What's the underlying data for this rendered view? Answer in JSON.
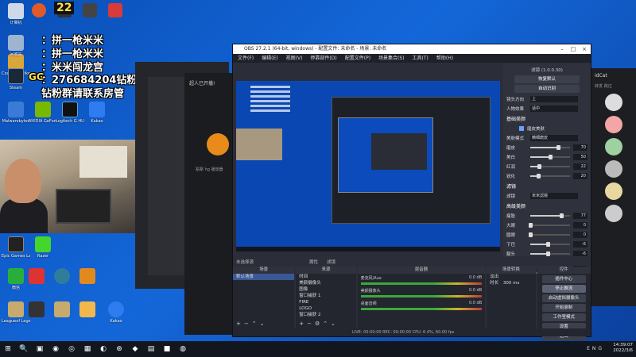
{
  "overlay": {
    "line1": "：拼一枪米米",
    "line2": "：拼一枪米米",
    "line3": "：米米闯龙宫",
    "line4": "：276684204钻粉群",
    "line5": "钻粉群请联系房管",
    "badge22": "22",
    "gg": "GG"
  },
  "desktop_icons": [
    {
      "label": "计算机",
      "color": "#cfd8e6"
    },
    {
      "label": "Counter-Strike",
      "color": "#d8a63a"
    },
    {
      "label": "回收站",
      "color": "#9fb4cf"
    },
    {
      "label": "Steam",
      "color": "#1b2838"
    },
    {
      "label": "Malwarebytes",
      "color": "#3a7bd5"
    },
    {
      "label": "NVIDIA GeForce",
      "color": "#76b900"
    },
    {
      "label": "Logitech G HUB",
      "color": "#111111"
    },
    {
      "label": "Epic Games Launcher",
      "color": "#222222"
    },
    {
      "label": "微信",
      "color": "#2aae3b"
    },
    {
      "label": "Leagueof Legends",
      "color": "#c8aa6e"
    },
    {
      "label": "Razer",
      "color": "#44d62c"
    },
    {
      "label": "Kakao",
      "color": "#2f7bf0"
    }
  ],
  "bg_app": {
    "left_text": "超人已开播!",
    "hint": "點擊 hg 播放器"
  },
  "obs": {
    "title": "OBS 27.2.1 (64-bit, windows) - 配置文件: 未命名 - 场景: 未命名",
    "menu": [
      "文件(F)",
      "编辑(E)",
      "视图(V)",
      "停靠部件(D)",
      "配置文件(P)",
      "场景集合(S)",
      "工具(T)",
      "帮助(H)"
    ],
    "props": {
      "title": "滤镜 (1.0.0.30)",
      "top_buttons": [
        "恢复默认",
        "自动识别"
      ],
      "face_label": "镜头方向",
      "face_value": "上",
      "person_label": "人物效果",
      "person_value": "适中",
      "section1": "基础美颜",
      "beauty_switch": "磨皮美肤",
      "beauty_mode_label": "美肤模式",
      "beauty_mode_value": "精细磨皮",
      "sliders1": [
        {
          "label": "磨皮",
          "value": "70",
          "pct": 0.7
        },
        {
          "label": "美白",
          "value": "50",
          "pct": 0.5
        },
        {
          "label": "红润",
          "value": "22",
          "pct": 0.22
        },
        {
          "label": "锐化",
          "value": "20",
          "pct": 0.2
        }
      ],
      "section2": "滤镜",
      "filter_label": "滤镜",
      "filter_value": "米米滤镜",
      "section3": "高级美颜",
      "sliders2": [
        {
          "label": "瘦脸",
          "value": "77",
          "pct": 0.77
        },
        {
          "label": "大眼",
          "value": "0",
          "pct": 0
        },
        {
          "label": "圆眼",
          "value": "0",
          "pct": 0
        },
        {
          "label": "下巴",
          "value": "-6",
          "pct": 0.44
        },
        {
          "label": "额头",
          "value": "-6",
          "pct": 0.44
        },
        {
          "label": "瘦鼻",
          "value": "0",
          "pct": 0
        },
        {
          "label": "嘴型",
          "value": "0",
          "pct": 0
        }
      ]
    },
    "toolrow": {
      "left": "未选择源",
      "props_btn": "属性",
      "filters_btn": "滤镜"
    },
    "docks": {
      "scenes": {
        "title": "场景",
        "items": [
          "默认场景"
        ]
      },
      "sources": {
        "title": "来源",
        "items": [
          "时间",
          "美颜摄像头",
          "图像",
          "窗口捕获 1",
          "FIRE",
          "LOGO",
          "窗口捕获 2"
        ]
      },
      "mixer": {
        "title": "混音器",
        "channels": [
          {
            "name": "麦克风/Aux",
            "db": "0.0 dB"
          },
          {
            "name": "美颜摄像头",
            "db": "0.0 dB"
          },
          {
            "name": "桌面音频",
            "db": "0.0 dB"
          }
        ]
      },
      "transitions": {
        "title": "场景转换",
        "type": "淡出",
        "duration_label": "时长",
        "duration_value": "300 ms"
      },
      "controls": {
        "title": "控件",
        "buttons": [
          "插件中心",
          "停止推流",
          "启动虚拟摄像头",
          "开始录制",
          "工作室模式",
          "设置",
          "退出"
        ]
      }
    },
    "status": "LIVE: 00:00:00   REC: 00:00:00   CPU: 6.4%, 60.00 fps"
  },
  "right_app": {
    "label1": "idCat",
    "label2": "转发 跳过"
  },
  "taskbar": {
    "apps": [
      "⊞",
      "🔍",
      "▣",
      "◉",
      "◎",
      "▦",
      "◐",
      "⊛",
      "◆",
      "▤",
      "■",
      "◍"
    ],
    "lang": "ENG",
    "time": "14:39:07",
    "date": "2022/3/6"
  }
}
